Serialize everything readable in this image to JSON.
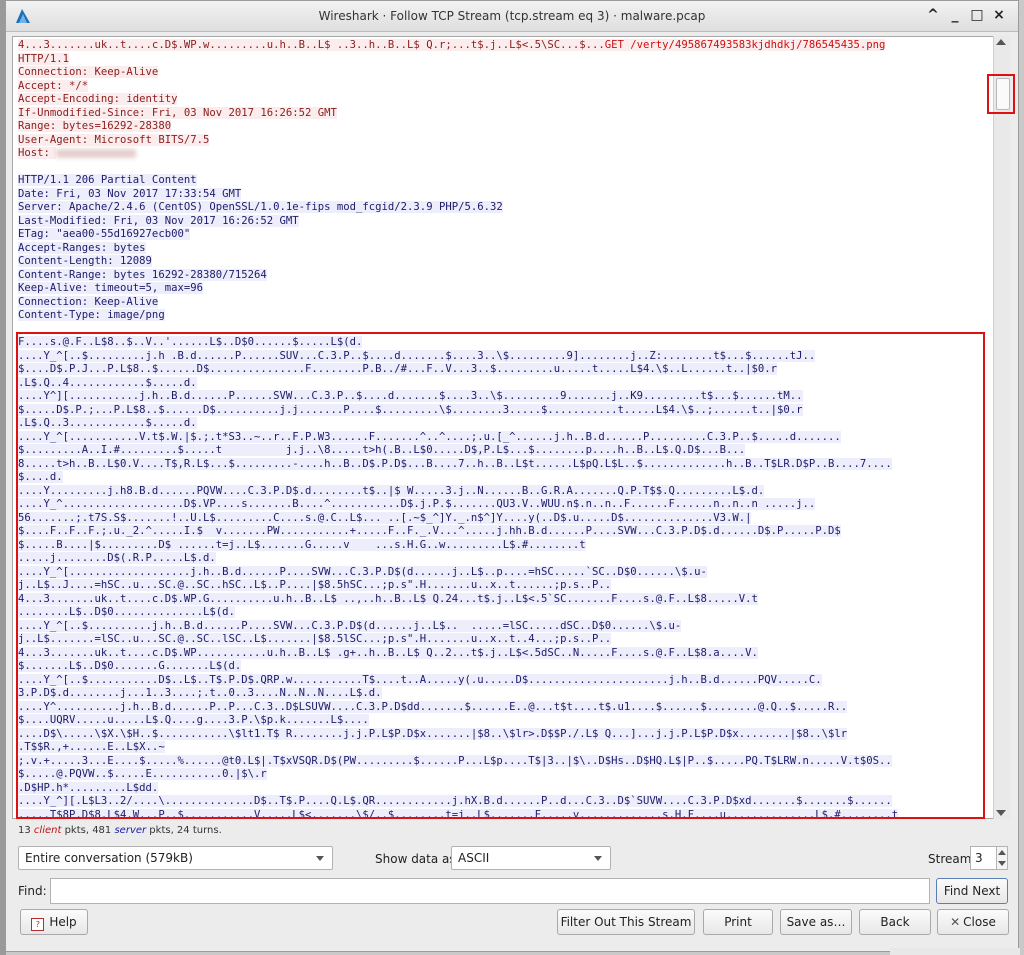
{
  "window": {
    "title": "Wireshark · Follow TCP Stream (tcp.stream eq 3) · malware.pcap",
    "controls": [
      "^",
      "_",
      "□",
      "×"
    ]
  },
  "stream": {
    "lines": [
      {
        "t": "c",
        "text": "4...3.......uk..t....c.D$.WP.w.........u.h..B..L$ ..3..h..B..L$ Q.r;...t$.j..L$<.5\\SC...$...",
        "get": "GET /verty/495867493583kjdhdkj/786545435.png"
      },
      {
        "t": "c",
        "text": "HTTP/1.1"
      },
      {
        "t": "c",
        "text": "Connection: Keep-Alive"
      },
      {
        "t": "c",
        "text": "Accept: */*"
      },
      {
        "t": "c",
        "text": "Accept-Encoding: identity"
      },
      {
        "t": "c",
        "text": "If-Unmodified-Since: Fri, 03 Nov 2017 16:26:52 GMT"
      },
      {
        "t": "c",
        "text": "Range: bytes=16292-28380"
      },
      {
        "t": "c",
        "text": "User-Agent: Microsoft BITS/7.5"
      },
      {
        "t": "c",
        "text": "Host: ",
        "blur": true
      },
      {
        "t": "b",
        "text": ""
      },
      {
        "t": "s",
        "text": "HTTP/1.1 206 Partial Content"
      },
      {
        "t": "s",
        "text": "Date: Fri, 03 Nov 2017 17:33:54 GMT"
      },
      {
        "t": "s",
        "text": "Server: Apache/2.4.6 (CentOS) OpenSSL/1.0.1e-fips mod_fcgid/2.3.9 PHP/5.6.32"
      },
      {
        "t": "s",
        "text": "Last-Modified: Fri, 03 Nov 2017 16:26:52 GMT"
      },
      {
        "t": "s",
        "text": "ETag: \"aea00-55d16927ecb00\""
      },
      {
        "t": "s",
        "text": "Accept-Ranges: bytes"
      },
      {
        "t": "s",
        "text": "Content-Length: 12089"
      },
      {
        "t": "s",
        "text": "Content-Range: bytes 16292-28380/715264"
      },
      {
        "t": "s",
        "text": "Keep-Alive: timeout=5, max=96"
      },
      {
        "t": "s",
        "text": "Connection: Keep-Alive"
      },
      {
        "t": "s",
        "text": "Content-Type: image/png"
      },
      {
        "t": "b",
        "text": ""
      },
      {
        "t": "s",
        "text": "F....s.@.F..L$8..$..V..'......L$..D$0......$.....L$(d."
      },
      {
        "t": "s",
        "text": "....Y_^[..$.........j.h .B.d......P......SUV...C.3.P..$....d.......$....3..\\$.........9]........j..Z:........t$...$......tJ.."
      },
      {
        "t": "s",
        "text": "$....D$.P.J...P.L$8..$......D$...............F........P.B../#...F..V...3..$.........u.....t.....L$4.\\$..L......t..|$0.r"
      },
      {
        "t": "s",
        "text": ".L$.Q..4............$.....d."
      },
      {
        "t": "s",
        "text": "....Y^][...........j.h..B.d......P......SVW...C.3.P..$....d.......$....3..\\$.........9.......j..K9.........t$...$......tM.."
      },
      {
        "t": "s",
        "text": "$.....D$.P.;...P.L$8..$......D$..........j.j.......P....$.........\\$........3.....$...........t.....L$4.\\$..;......t..|$0.r"
      },
      {
        "t": "s",
        "text": ".L$.Q..3............$.....d."
      },
      {
        "t": "s",
        "text": "....Y_^[...........V.t$.W.|$.;.t*S3..~..r..F.P.W3......F.......^..^....;.u.[_^......j.h..B.d......P.........C.3.P..$.....d......."
      },
      {
        "t": "s",
        "text": "$.........A..I.#.........$.....t          j.j..\\8.....t>h(.B..L$0.....D$,P.L$...$........p....h..B..L$.Q.D$...B..."
      },
      {
        "t": "s",
        "text": "8.....t>h..B..L$0.V....T$,R.L$...$.........-....h..B..D$.P.D$...B....7..h..B..L$t......L$pQ.L$L..$.............h..B..T$LR.D$P..B....7...."
      },
      {
        "t": "s",
        "text": "$....d."
      },
      {
        "t": "s",
        "text": "....Y.........j.h8.B.d......PQVW....C.3.P.D$.d........t$..|$ W.....3.j..N......B..G.R.A.......Q.P.T$$.Q.........L$.d."
      },
      {
        "t": "s",
        "text": "....Y_^...................D$.VP....s.......B....^...........D$.j.P.$.......QU3.V..WUU.n$.n..n..F......F......n..n..n .....j.."
      },
      {
        "t": "s",
        "text": "56.......;.t7S.S$.......!..U.L$.........C....s.@.C..L$... ..[.~$_^]Y._.n$^]Y....y(..D$.u.....D$..............V3.W.|"
      },
      {
        "t": "s",
        "text": "$....F..F..F.;.u._2.^.....I.$  v.......PW...........+.....F..F._.V...^.....j.hh.B.d......P....SVW...C.3.P.D$.d......D$.P.....P.D$"
      },
      {
        "t": "s",
        "text": "$.....B....|$.........D$ ......t=j..L$.......G.....v    ...s.H.G..w.........L$.#........t"
      },
      {
        "t": "s",
        "text": ".....j........D$(.R.P.....L$.d."
      },
      {
        "t": "s",
        "text": "....Y_^[...................j.h..B.d......P....SVW...C.3.P.D$(d......j..L$..p....=hSC.....`SC..D$0......\\$.u-"
      },
      {
        "t": "s",
        "text": "j..L$..J....=hSC..u...SC.@..SC..hSC..L$..P....|$8.5hSC...;p.s\".H.......u..x..t......;p.s..P.."
      },
      {
        "t": "s",
        "text": "4...3.......uk..t....c.D$.WP.G..........u.h..B..L$ ..,..h..B..L$ Q.24...t$.j..L$<.5`SC.......F....s.@.F..L$8.....V.t"
      },
      {
        "t": "s",
        "text": "........L$..D$0..............L$(d."
      },
      {
        "t": "s",
        "text": "....Y_^[..$..........j.h..B.d......P....SVW...C.3.P.D$(d......j..L$..  .....=lSC.....dSC..D$0......\\$.u-"
      },
      {
        "t": "s",
        "text": "j..L$.......=lSC..u...SC.@..SC..lSC..L$.......|$8.5lSC...;p.s\".H.......u..x..t..4...;p.s..P.."
      },
      {
        "t": "s",
        "text": "4...3.......uk..t....c.D$.WP...........u.h..B..L$ .g+..h..B..L$ Q..2...t$.j..L$<.5dSC..N.....F....s.@.F..L$8.a....V."
      },
      {
        "t": "s",
        "text": "$.......L$..D$0.......G.......L$(d."
      },
      {
        "t": "s",
        "text": "....Y_^[..$...........D$..L$..T$.P.D$.QRP.w...........T$....t..A.....y(.u.....D$......................j.h..B.d......PQV.....C."
      },
      {
        "t": "s",
        "text": "3.P.D$.d........j...1..3....;.t..0..3....N..N..N....L$.d."
      },
      {
        "t": "s",
        "text": "....Y^..........j.h..B.d......P..P...C.3..D$LSUVW....C.3.P.D$dd.......$......E..@...t$t....t$.u1....$......$........@.Q..$.....R.."
      },
      {
        "t": "s",
        "text": "$....UQRV.....u.....L$.Q....g....3.P.\\$p.k.......L$...."
      },
      {
        "t": "s",
        "text": "....D$\\.....\\$X.\\$H..$...........\\$lt1.T$ R........j.j.P.L$P.D$x.......|$8..\\$lr>.D$$P./.L$ Q...]...j.j.P.L$P.D$x........|$8..\\$lr"
      },
      {
        "t": "s",
        "text": ".T$$R.,+......E..L$X..~"
      },
      {
        "t": "s",
        "text": ";.v.+.....3...E....$.....%......@t0.L$|.T$xVSQR.D$(PW.........$......P...L$p....T$|3..|$\\..D$Hs..D$HQ.L$|P..$.....PQ.T$LRW.n.....V.t$0S.."
      },
      {
        "t": "s",
        "text": "$.....@.PQVW..$.....E...........0.|$\\.r"
      },
      {
        "t": "s",
        "text": ".D$HP.h*.........L$dd."
      },
      {
        "t": "s",
        "text": "....Y_^][.L$L3..2/....\\..............D$..T$.P....Q.L$.QR............j.hX.B.d......P..d...C.3..D$`SUVW....C.3.P.D$xd.......$.......$......"
      },
      {
        "t": "s",
        "text": ".....T$8P.D$8.L$4.W...P..$...........V.....L$<.......\\$/..$........t=j..L$.......F.....v.............s.H.F....u..............L$.#........t"
      }
    ]
  },
  "summary": {
    "client_count": "13",
    "client_word": "client",
    "middle": " pkts, 481 ",
    "server_word": "server",
    "tail": " pkts, 24 turns."
  },
  "controls": {
    "conversation_select": "Entire conversation (579kB)",
    "show_data_label": "Show data as",
    "show_data_select": "ASCII",
    "stream_label": "Stream",
    "stream_value": "3",
    "find_label": "Find:",
    "find_value": "",
    "find_next": "Find Next"
  },
  "buttons": {
    "help": "Help",
    "filter_out": "Filter Out This Stream",
    "print": "Print",
    "save_as": "Save as…",
    "back": "Back",
    "close": "Close"
  },
  "colors": {
    "client_text": "#8b1d1d",
    "client_bg": "#fbeded",
    "server_text": "#1c1c6a",
    "server_bg": "#ededfb",
    "highlight": "#e01010"
  }
}
